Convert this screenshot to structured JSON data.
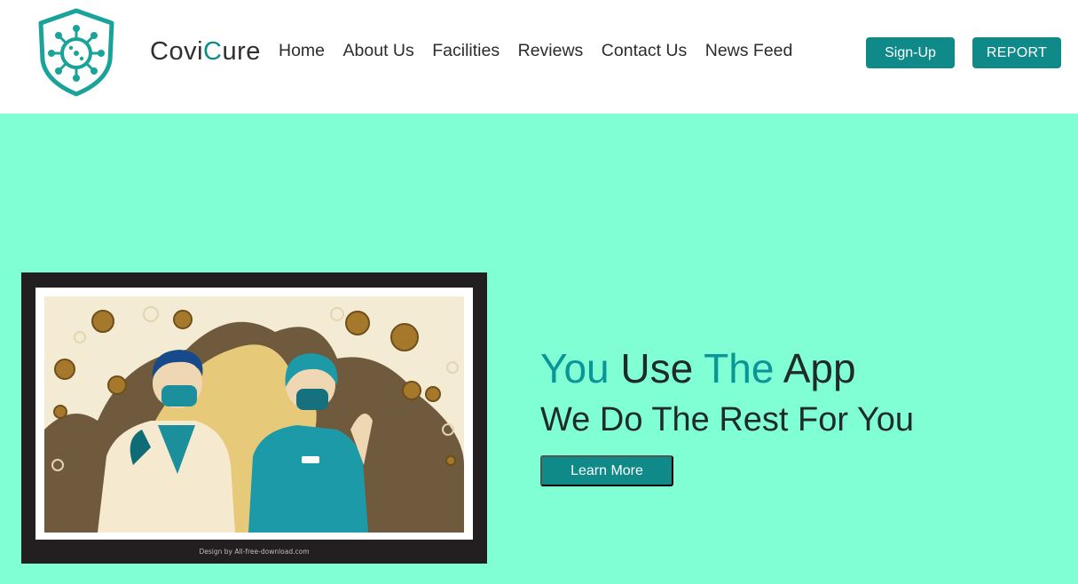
{
  "brand": {
    "part1": "Covi",
    "part2": "C",
    "part3": "ure"
  },
  "nav": {
    "items": [
      "Home",
      "About Us",
      "Facilities",
      "Reviews",
      "Contact Us",
      "News Feed"
    ]
  },
  "header_buttons": {
    "signup": "Sign-Up",
    "report": "REPORT"
  },
  "hero": {
    "headline": {
      "w1": "You",
      "w2": "Use",
      "w3": "The",
      "w4": "App"
    },
    "subline": "We Do The Rest For You",
    "cta": "Learn More",
    "poster_credit": "Design by All-free-download.com"
  },
  "colors": {
    "accent": "#0f8a88",
    "hero_bg": "#80ffd4",
    "teal_text": "#0b9597"
  }
}
